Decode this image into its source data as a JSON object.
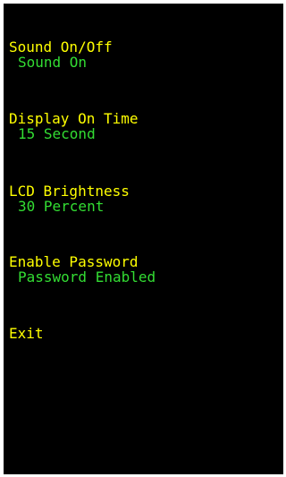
{
  "menu": {
    "items": [
      {
        "label": "Sound On/Off",
        "value": "Sound On"
      },
      {
        "label": "Display On Time",
        "value": "15 Second"
      },
      {
        "label": "LCD Brightness",
        "value": "30 Percent"
      },
      {
        "label": "Enable Password",
        "value": "Password Enabled"
      },
      {
        "label": "Exit"
      }
    ]
  },
  "colors": {
    "background": "#000000",
    "label": "#ffff00",
    "value": "#33dd33"
  }
}
